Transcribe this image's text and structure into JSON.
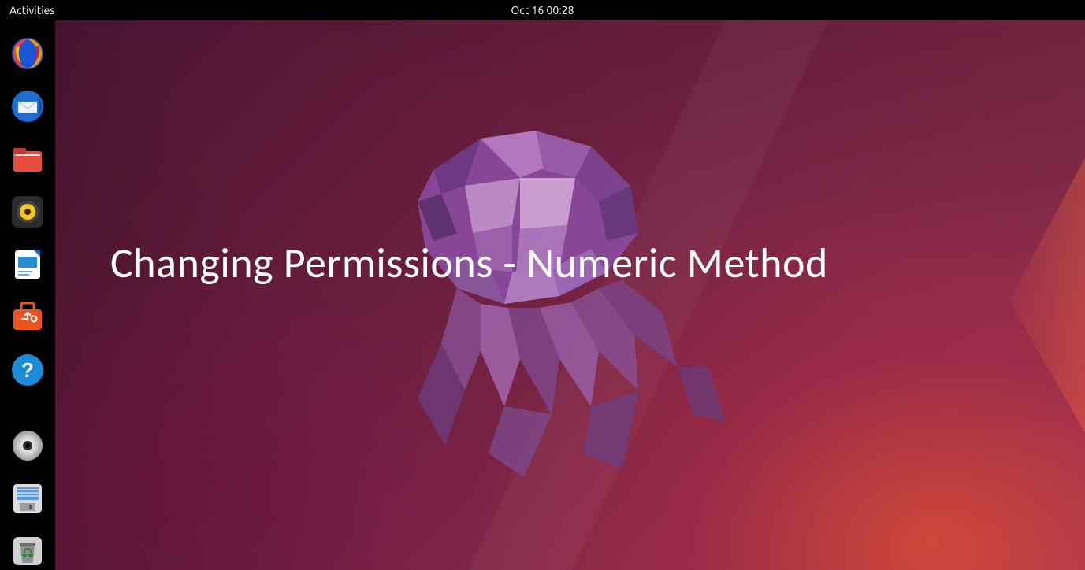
{
  "topbar": {
    "activities": "Activities",
    "clock": "Oct 16  00:28"
  },
  "dock": {
    "items": [
      {
        "name": "firefox",
        "label": "Firefox"
      },
      {
        "name": "thunderbird",
        "label": "Thunderbird"
      },
      {
        "name": "files",
        "label": "Files"
      },
      {
        "name": "rhythmbox",
        "label": "Rhythmbox"
      },
      {
        "name": "libreoffice-writer",
        "label": "LibreOffice Writer"
      },
      {
        "name": "software",
        "label": "Ubuntu Software"
      },
      {
        "name": "help",
        "label": "Help"
      },
      {
        "name": "disc",
        "label": "Disc"
      },
      {
        "name": "save",
        "label": "Save"
      },
      {
        "name": "trash",
        "label": "Trash"
      }
    ]
  },
  "desktop": {
    "overlay_text": "Changing Permissions - Numeric Method"
  }
}
